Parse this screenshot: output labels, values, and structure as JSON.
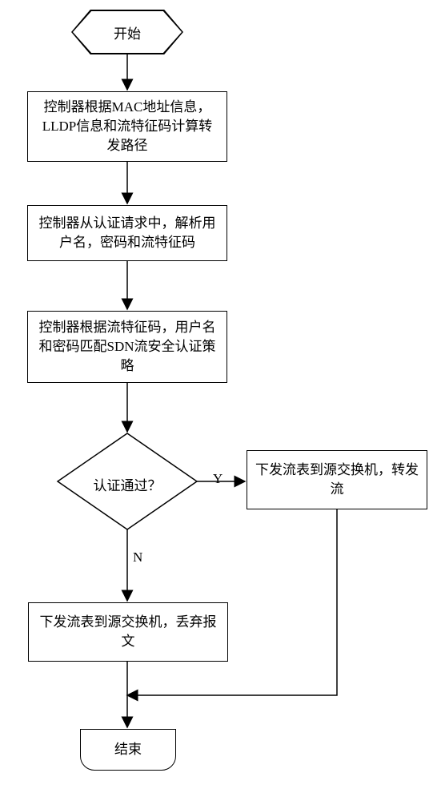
{
  "flowchart": {
    "start": "开始",
    "step1": "控制器根据MAC地址信息，LLDP信息和流特征码计算转发路径",
    "step2": "控制器从认证请求中，解析用户名，密码和流特征码",
    "step3": "控制器根据流特征码，用户名和密码匹配SDN流安全认证策略",
    "decision": "认证通过？",
    "yes_label": "Y",
    "no_label": "N",
    "yes_action": "下发流表到源交换机，转发流",
    "no_action": "下发流表到源交换机，丢弃报文",
    "end": "结束"
  }
}
